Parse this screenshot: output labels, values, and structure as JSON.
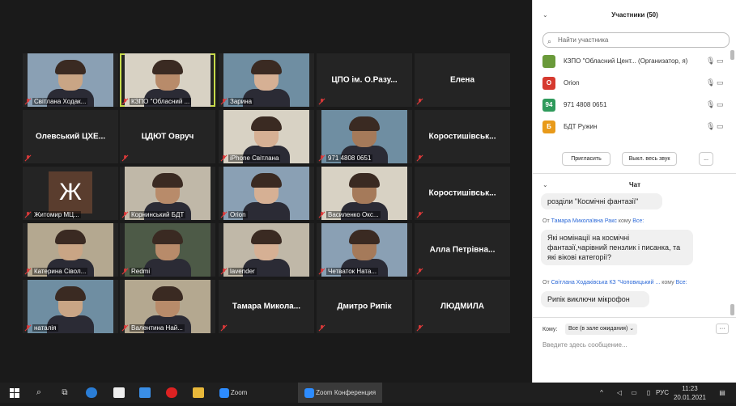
{
  "gallery": {
    "tiles": [
      {
        "name": "Світлана Ходак...",
        "type": "video",
        "active": false
      },
      {
        "name": "КЗПО \"Обласний ...",
        "type": "video",
        "active": true
      },
      {
        "name": "Зарина",
        "type": "video",
        "active": false
      },
      {
        "name": "ЦПО ім. О.Разу...",
        "type": "name",
        "active": false
      },
      {
        "name": "Елена",
        "type": "name",
        "active": false
      },
      {
        "name": "Олевський ЦХЕ...",
        "type": "name",
        "active": false
      },
      {
        "name": "ЦДЮТ Овруч",
        "type": "name",
        "active": false
      },
      {
        "name": "iPhone Світлана",
        "type": "video",
        "active": false
      },
      {
        "name": "971 4808 0651",
        "type": "video",
        "active": false
      },
      {
        "name": "Коростишівськ...",
        "type": "name",
        "active": false
      },
      {
        "name": "Житомир МЦ...",
        "type": "avatar",
        "letter": "Ж",
        "active": false
      },
      {
        "name": "Корнинський БДТ",
        "type": "video",
        "active": false
      },
      {
        "name": "Orion",
        "type": "video",
        "active": false
      },
      {
        "name": "Василенко Окс...",
        "type": "video",
        "active": false
      },
      {
        "name": "Коростишівськ...",
        "type": "name",
        "active": false
      },
      {
        "name": "Катерина Сівол...",
        "type": "video",
        "active": false
      },
      {
        "name": "Redmi",
        "type": "video",
        "active": false
      },
      {
        "name": "lavender",
        "type": "video",
        "active": false
      },
      {
        "name": "Четваток Ната...",
        "type": "video",
        "active": false
      },
      {
        "name": "Алла Петрівна...",
        "type": "name",
        "active": false
      },
      {
        "name": "наталія",
        "type": "video",
        "active": false
      },
      {
        "name": "Валентина Най...",
        "type": "video",
        "active": false
      },
      {
        "name": "Тамара Микола...",
        "type": "name",
        "active": false
      },
      {
        "name": "Дмитро Рипік",
        "type": "name",
        "active": false
      },
      {
        "name": "ЛЮДМИЛА",
        "type": "name",
        "active": false
      }
    ]
  },
  "participants": {
    "title": "Участники (50)",
    "search_placeholder": "Найти участника",
    "list": [
      {
        "avatar": "",
        "name": "КЗПО \"Обласний Цент...",
        "role": "(Организатор, я)",
        "color": "#6a9a3a"
      },
      {
        "avatar": "O",
        "name": "Orion",
        "role": "",
        "color": "#d63a2f"
      },
      {
        "avatar": "94",
        "name": "971 4808 0651",
        "role": "",
        "color": "#2e9a5b"
      },
      {
        "avatar": "Б",
        "name": "БДТ Ружин",
        "role": "",
        "color": "#e89a1a"
      }
    ],
    "invite_label": "Пригласить",
    "mute_all_label": "Выкл. весь звук",
    "more_label": "..."
  },
  "chat": {
    "title": "Чат",
    "msg1_text": "розділи \"Космічні фантазії\"",
    "msg2_from_prefix": "От",
    "msg2_sender": "Тамара Миколаївна Ракс",
    "msg2_to_prefix": "кому",
    "msg2_to": "Все:",
    "msg2_text": "Які номінації на космічні фантазії,чарівний пензлик і писанка, та які вікові категорії?",
    "msg3_from_prefix": "От",
    "msg3_sender": "Світлана Ходаківська КЗ \"Чоповицький ...",
    "msg3_to_prefix": "кому",
    "msg3_to": "Все:",
    "msg3_text": "Рипік виключи мікрофон",
    "to_label": "Кому:",
    "to_value": "Все (в зале ожидания)",
    "input_placeholder": "Введите здесь сообщение..."
  },
  "taskbar": {
    "zoom_label": "Zoom",
    "zoom_conf_label": "Zoom Конференция",
    "lang": "РУС",
    "time": "11:23",
    "date": "20.01.2021"
  }
}
